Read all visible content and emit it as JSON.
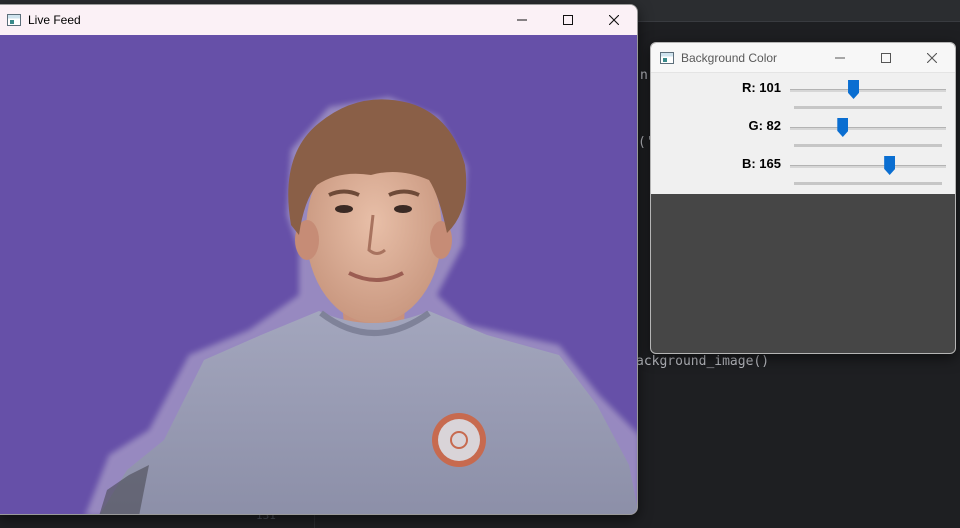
{
  "ide": {
    "line_fragments": [
      {
        "text": "n"
      },
      {
        "text": "('"
      },
      {
        "text": "ackground_image()"
      }
    ],
    "line_number": "131"
  },
  "live_feed": {
    "title": "Live Feed",
    "icon": "app-window-icon",
    "background_color": "#6650a8"
  },
  "background_color_window": {
    "title": "Background Color",
    "icon": "app-window-icon",
    "sliders": [
      {
        "label": "R: 101",
        "value": 101,
        "max": 255
      },
      {
        "label": "G: 82",
        "value": 82,
        "max": 255
      },
      {
        "label": "B: 165",
        "value": 165,
        "max": 255
      }
    ],
    "accent": "#0a6ed1"
  }
}
